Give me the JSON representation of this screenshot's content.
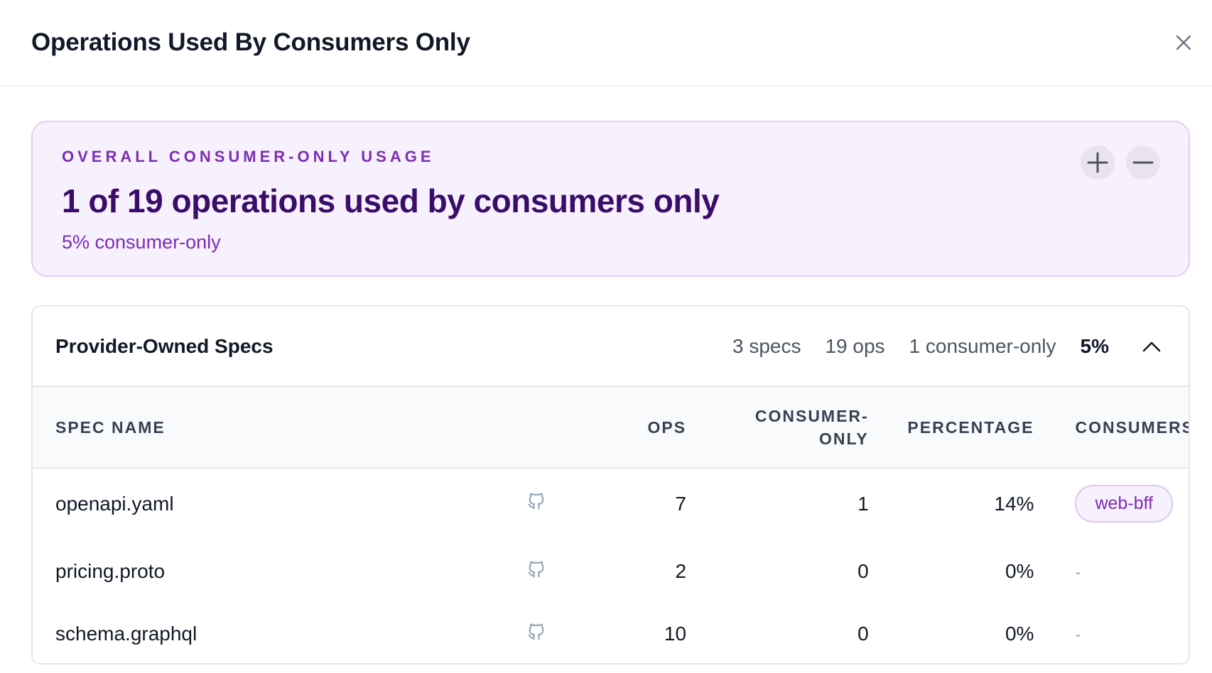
{
  "modal": {
    "title": "Operations Used By Consumers Only",
    "close_icon": "close-icon"
  },
  "summary": {
    "eyebrow": "OVERALL CONSUMER-ONLY USAGE",
    "headline": "1 of 19 operations used by consumers only",
    "subtext": "5% consumer-only",
    "zoom_in_icon": "plus-icon",
    "zoom_out_icon": "minus-icon",
    "colors": {
      "accent": "#7c2db5",
      "headline": "#3b0d6b",
      "background": "#f7f0fd",
      "border": "#e4cdf7"
    }
  },
  "specs_panel": {
    "title": "Provider-Owned Specs",
    "stats": {
      "specs": "3 specs",
      "ops": "19 ops",
      "consumer_only": "1 consumer-only",
      "percentage": "5%"
    },
    "collapse_icon": "chevron-up-icon",
    "columns": {
      "spec_name": "SPEC NAME",
      "ops": "OPS",
      "consumer_only_line1": "CONSUMER-",
      "consumer_only_line2": "ONLY",
      "percentage": "PERCENTAGE",
      "consumers": "CONSUMERS"
    },
    "rows": [
      {
        "spec_name": "openapi.yaml",
        "repo_icon": "github-icon",
        "ops": "7",
        "consumer_only": "1",
        "percentage": "14%",
        "consumers": [
          "web-bff"
        ]
      },
      {
        "spec_name": "pricing.proto",
        "repo_icon": "github-icon",
        "ops": "2",
        "consumer_only": "0",
        "percentage": "0%",
        "consumers_empty": "-"
      },
      {
        "spec_name": "schema.graphql",
        "repo_icon": "github-icon",
        "ops": "10",
        "consumer_only": "0",
        "percentage": "0%",
        "consumers_empty": "-"
      }
    ]
  }
}
